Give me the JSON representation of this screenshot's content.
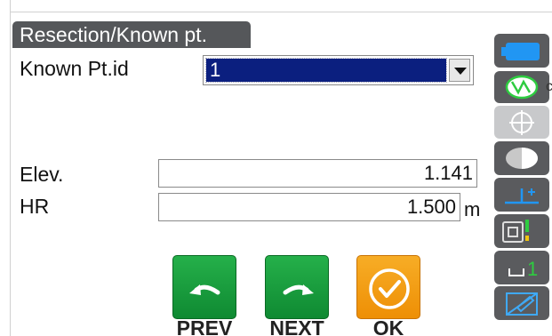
{
  "title": "Resection/Known pt.",
  "known_pt": {
    "label": "Known Pt.id",
    "value": "1"
  },
  "elev": {
    "label": "Elev.",
    "value": "1.141"
  },
  "hr": {
    "label": "HR",
    "value": "1.500",
    "unit": "m"
  },
  "softkeys": [
    {
      "label": "PREV",
      "icon": "arrow-left-icon",
      "color": "#1a9e3f"
    },
    {
      "label": "NEXT",
      "icon": "arrow-right-icon",
      "color": "#1a9e3f"
    },
    {
      "label": "OK",
      "icon": "check-circle-icon",
      "color": "#f39c12"
    }
  ],
  "side_icons": [
    "battery-icon",
    "prism-target-icon",
    "crosshair-icon",
    "contrast-icon",
    "tilt-compensation-icon",
    "laser-signal-icon",
    "level-one-icon",
    "tablet-pen-icon"
  ],
  "side_cut_text": "c"
}
